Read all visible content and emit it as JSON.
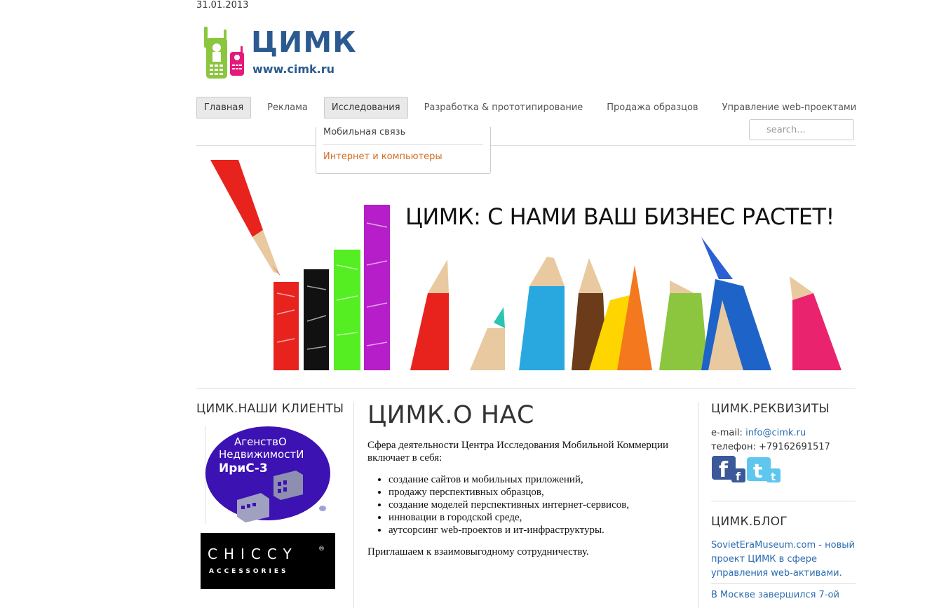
{
  "date": "31.01.2013",
  "logo": {
    "title": "ЦИМК",
    "url": "www.cimk.ru"
  },
  "nav": {
    "items": [
      {
        "label": "Главная",
        "active": true
      },
      {
        "label": "Реклама",
        "active": false
      },
      {
        "label": "Исследования",
        "active": true
      },
      {
        "label": "Разработка & прототипирование",
        "active": false
      },
      {
        "label": "Продажа образцов",
        "active": false
      },
      {
        "label": "Управление web-проектами",
        "active": false
      }
    ]
  },
  "dropdown": {
    "items": [
      "Мобильная связь",
      "Интернет и компьютеры"
    ]
  },
  "search": {
    "placeholder": "search..."
  },
  "banner": {
    "text": "ЦИМК: С НАМИ ВАШ БИЗНЕС РАСТЕТ!"
  },
  "clients": {
    "title": "ЦИМК.НАШИ КЛИЕНТЫ",
    "iris": {
      "line1": "АгенствО",
      "line2": "НедвижимостИ",
      "line3": "ИриС-3"
    },
    "chiccy": {
      "name": "CHICCY",
      "reg": "®",
      "sub": "ACCESSORIES"
    }
  },
  "about": {
    "title": "ЦИМК.О НАС",
    "intro": "Сфера деятельности Центра Исследования Мобильной Коммерции включает в себя:",
    "bullets": [
      "создание сайтов и мобильных приложений,",
      "продажу перспективных образцов,",
      "создание моделей перспективных интернет-сервисов,",
      "инновации в городской среде,",
      "аутсорсинг web-проектов и ит-инфраструктуры."
    ],
    "outro": "Приглашаем к взаимовыгодному сотрудничеству."
  },
  "requisites": {
    "title": "ЦИМК.РЕКВИЗИТЫ",
    "email_label": "e-mail:",
    "email": "info@cimk.ru",
    "phone": "телефон: +79162691517"
  },
  "blog": {
    "title": "ЦИМК.БЛОГ",
    "items": [
      "SovietEraMuseum.com - новый проект ЦИМК в сфере управления web-активами.",
      "В Москве завершился 7-ой"
    ]
  },
  "colors": {
    "brand": "#2b5a91",
    "link": "#2b6cb0",
    "dropdown_active": "#d2691e",
    "iris_purple": "#3d12b3"
  }
}
